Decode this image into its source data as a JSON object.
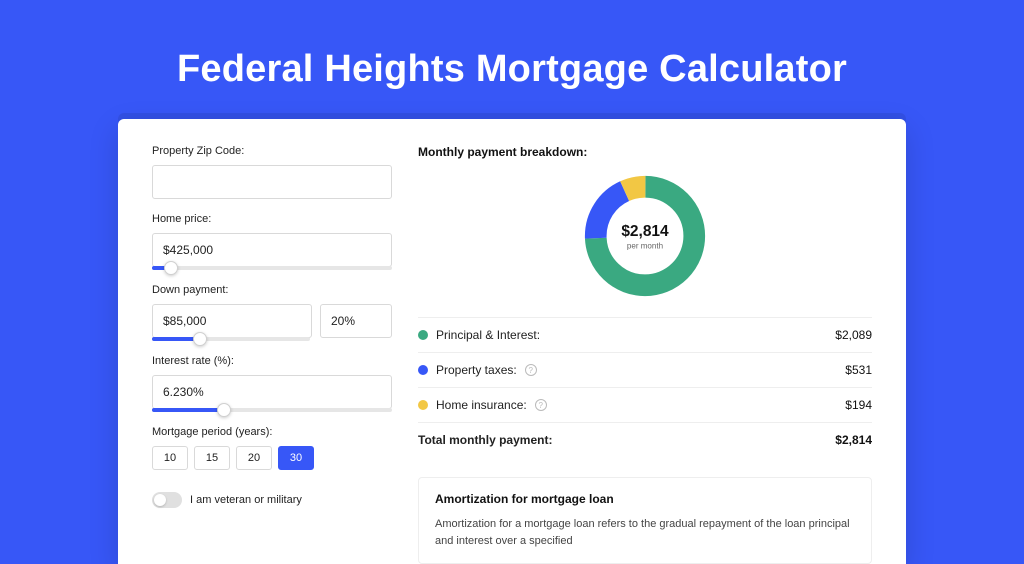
{
  "hero": {
    "title": "Federal Heights Mortgage Calculator"
  },
  "form": {
    "zip_label": "Property Zip Code:",
    "zip_value": "",
    "price_label": "Home price:",
    "price_value": "$425,000",
    "price_slider_pct": 8,
    "down_label": "Down payment:",
    "down_value": "$85,000",
    "down_pct": "20%",
    "down_slider_pct": 20,
    "rate_label": "Interest rate (%):",
    "rate_value": "6.230%",
    "rate_slider_pct": 30,
    "period_label": "Mortgage period (years):",
    "periods": [
      "10",
      "15",
      "20",
      "30"
    ],
    "period_active": "30",
    "veteran_label": "I am veteran or military"
  },
  "breakdown": {
    "title": "Monthly payment breakdown:",
    "center_amount": "$2,814",
    "center_sub": "per month",
    "items": [
      {
        "label": "Principal & Interest:",
        "value": "$2,089",
        "info": false,
        "color": "green"
      },
      {
        "label": "Property taxes:",
        "value": "$531",
        "info": true,
        "color": "blue"
      },
      {
        "label": "Home insurance:",
        "value": "$194",
        "info": true,
        "color": "yellow"
      }
    ],
    "total_label": "Total monthly payment:",
    "total_value": "$2,814"
  },
  "amortization": {
    "title": "Amortization for mortgage loan",
    "body": "Amortization for a mortgage loan refers to the gradual repayment of the loan principal and interest over a specified"
  },
  "chart_data": {
    "type": "pie",
    "title": "Monthly payment breakdown",
    "series": [
      {
        "name": "Principal & Interest",
        "value": 2089,
        "color": "#3aa981"
      },
      {
        "name": "Property taxes",
        "value": 531,
        "color": "#3757f7"
      },
      {
        "name": "Home insurance",
        "value": 194,
        "color": "#f2c744"
      }
    ],
    "total": 2814,
    "center_label": "$2,814 per month"
  }
}
